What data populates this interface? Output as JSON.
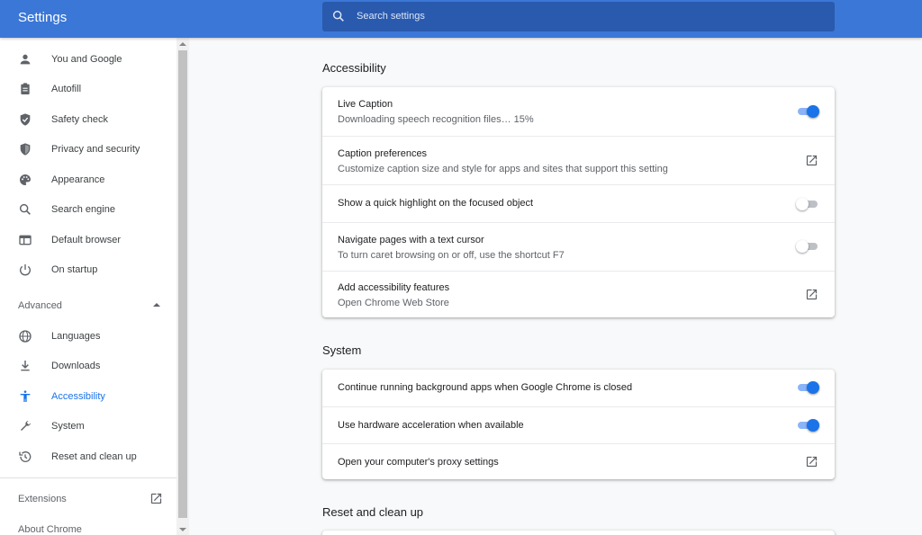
{
  "header": {
    "title": "Settings",
    "search_placeholder": "Search settings"
  },
  "sidebar": {
    "items": [
      {
        "label": "You and Google",
        "icon": "person-icon"
      },
      {
        "label": "Autofill",
        "icon": "clipboard-icon"
      },
      {
        "label": "Safety check",
        "icon": "shield-check-icon"
      },
      {
        "label": "Privacy and security",
        "icon": "shield-icon"
      },
      {
        "label": "Appearance",
        "icon": "palette-icon"
      },
      {
        "label": "Search engine",
        "icon": "search-icon"
      },
      {
        "label": "Default browser",
        "icon": "browser-icon"
      },
      {
        "label": "On startup",
        "icon": "power-icon"
      }
    ],
    "advanced_label": "Advanced",
    "advanced_items": [
      {
        "label": "Languages",
        "icon": "globe-icon"
      },
      {
        "label": "Downloads",
        "icon": "download-icon"
      },
      {
        "label": "Accessibility",
        "icon": "accessibility-icon",
        "active": true
      },
      {
        "label": "System",
        "icon": "wrench-icon"
      },
      {
        "label": "Reset and clean up",
        "icon": "history-icon"
      }
    ],
    "extensions_label": "Extensions",
    "about_label": "About Chrome"
  },
  "main": {
    "accessibility": {
      "heading": "Accessibility",
      "rows": [
        {
          "title": "Live Caption",
          "subtitle": "Downloading speech recognition files… 15%",
          "control": "toggle",
          "on": true
        },
        {
          "title": "Caption preferences",
          "subtitle": "Customize caption size and style for apps and sites that support this setting",
          "control": "launch"
        },
        {
          "title": "Show a quick highlight on the focused object",
          "control": "toggle",
          "on": false
        },
        {
          "title": "Navigate pages with a text cursor",
          "subtitle": "To turn caret browsing on or off, use the shortcut F7",
          "control": "toggle",
          "on": false
        },
        {
          "title": "Add accessibility features",
          "subtitle": "Open Chrome Web Store",
          "control": "launch"
        }
      ]
    },
    "system": {
      "heading": "System",
      "rows": [
        {
          "title": "Continue running background apps when Google Chrome is closed",
          "control": "toggle",
          "on": true
        },
        {
          "title": "Use hardware acceleration when available",
          "control": "toggle",
          "on": true
        },
        {
          "title": "Open your computer's proxy settings",
          "control": "launch"
        }
      ]
    },
    "reset": {
      "heading": "Reset and clean up"
    }
  },
  "colors": {
    "header_bg": "#3b77d6",
    "accent": "#1a73e8",
    "toggle_track_on": "#8ab4f8"
  }
}
